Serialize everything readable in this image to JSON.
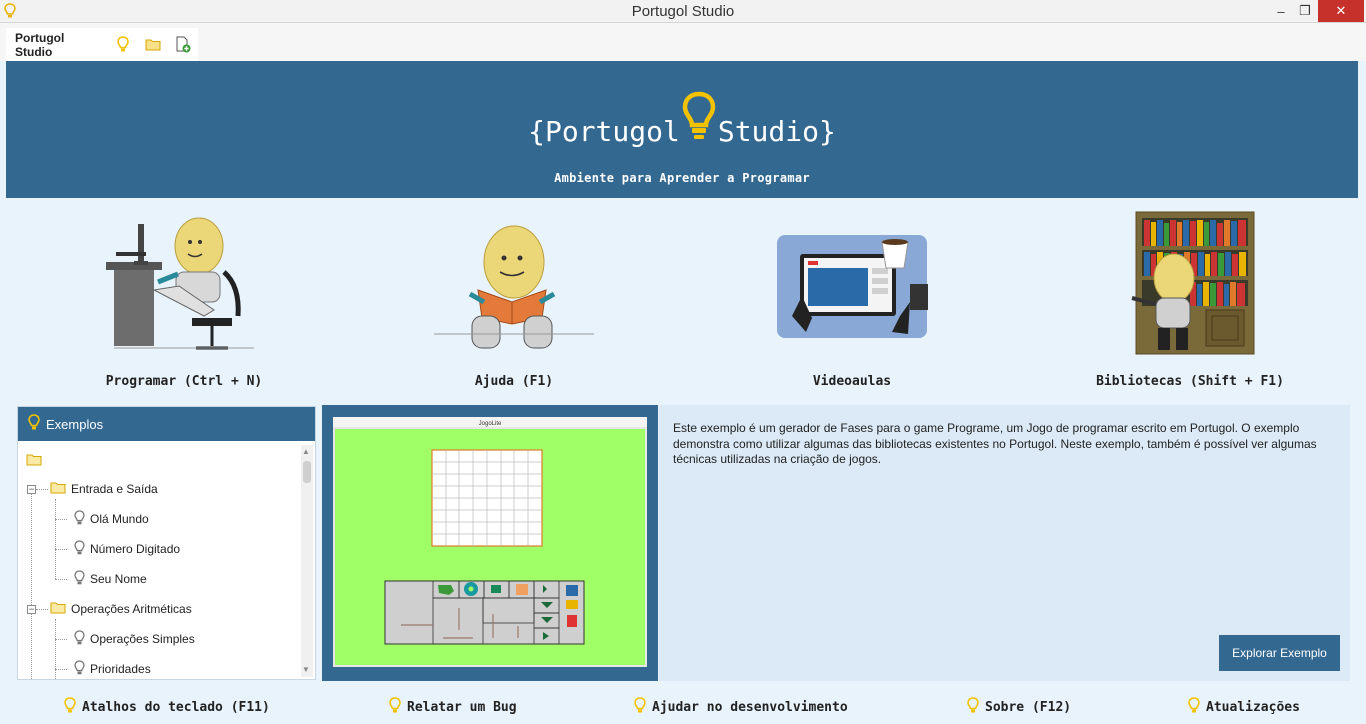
{
  "window": {
    "title": "Portugol Studio",
    "controls": {
      "minimize": "–",
      "maximize": "❐",
      "close": "✕"
    }
  },
  "tabs": [
    {
      "label": "Portugol Studio"
    }
  ],
  "tab_icons": [
    "bulb-icon",
    "folder-icon",
    "new-file-icon"
  ],
  "header": {
    "logo_left": "{Portugol",
    "logo_right": "Studio}",
    "subtitle": "Ambiente para Aprender a Programar"
  },
  "actions": [
    {
      "label": "Programar (Ctrl + N)"
    },
    {
      "label": "Ajuda (F1)"
    },
    {
      "label": "Videoaulas"
    },
    {
      "label": "Bibliotecas (Shift + F1)"
    }
  ],
  "examples": {
    "title": "Exemplos",
    "tree": [
      {
        "label": "",
        "type": "folder",
        "level": 0
      },
      {
        "label": "Entrada e Saída",
        "type": "folder",
        "level": 1,
        "expanded": true
      },
      {
        "label": "Olá Mundo",
        "type": "file",
        "level": 2
      },
      {
        "label": "Número Digitado",
        "type": "file",
        "level": 2
      },
      {
        "label": "Seu Nome",
        "type": "file",
        "level": 2
      },
      {
        "label": "Operações Aritméticas",
        "type": "folder",
        "level": 1,
        "expanded": true
      },
      {
        "label": "Operações Simples",
        "type": "file",
        "level": 2
      },
      {
        "label": "Prioridades",
        "type": "file",
        "level": 2
      }
    ]
  },
  "preview": {
    "window_title": "JogoLite"
  },
  "description": {
    "text": "Este exemplo é um gerador de Fases para o game Programe, um Jogo de programar escrito em Portugol. O exemplo demonstra como utilizar algumas das bibliotecas existentes no Portugol. Neste exemplo, também é possível ver algumas técnicas utilizadas na criação de jogos.",
    "button": "Explorar Exemplo"
  },
  "footer": [
    {
      "label": "Atalhos do teclado (F11)"
    },
    {
      "label": "Relatar um Bug"
    },
    {
      "label": "Ajudar no desenvolvimento"
    },
    {
      "label": "Sobre (F12)"
    },
    {
      "label": "Atualizações"
    }
  ],
  "colors": {
    "primary": "#336891",
    "accent": "#f2c200",
    "background": "#e9f3fb",
    "close": "#c7312b",
    "preview_bg": "#a0ff66"
  }
}
